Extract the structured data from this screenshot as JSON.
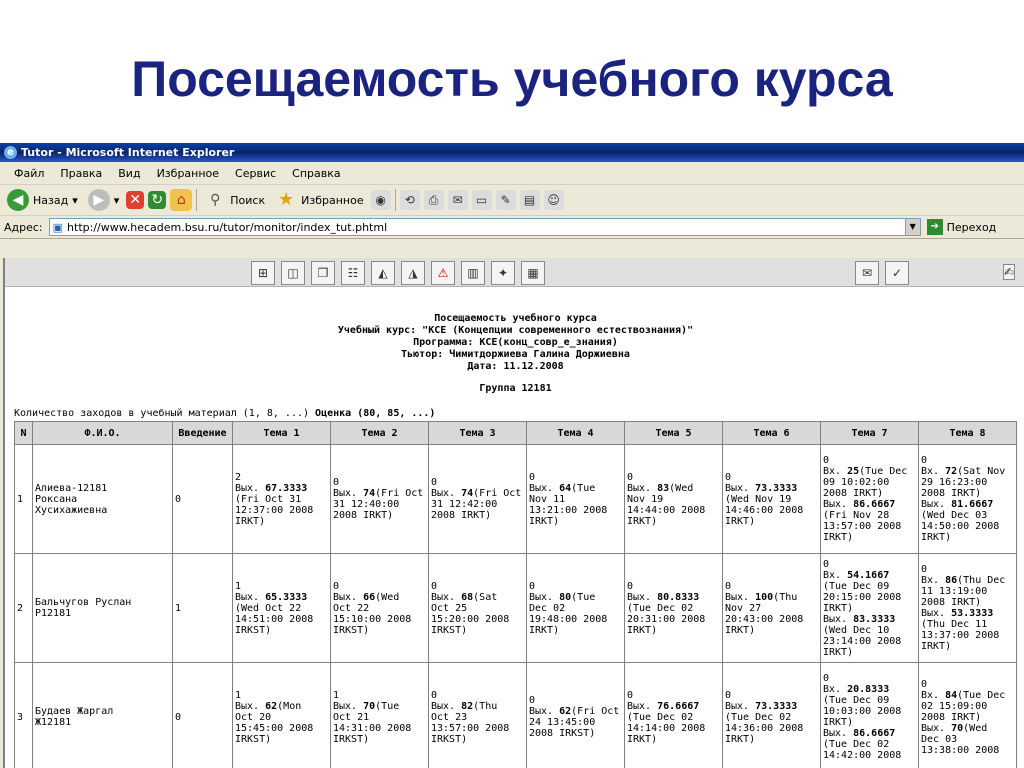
{
  "slide": {
    "title": "Посещаемость учебного курса"
  },
  "window": {
    "title": "Tutor - Microsoft Internet Explorer"
  },
  "menu": [
    "Файл",
    "Правка",
    "Вид",
    "Избранное",
    "Сервис",
    "Справка"
  ],
  "toolbar": {
    "back": "Назад",
    "search": "Поиск",
    "favorites": "Избранное"
  },
  "address": {
    "label": "Адрес:",
    "url": "http://www.hecadem.bsu.ru/tutor/monitor/index_tut.phtml",
    "go": "Переход"
  },
  "report": {
    "title": "Посещаемость учебного курса",
    "course": "Учебный курс: \"КСЕ (Концепции современного естествознания)\"",
    "program": "Программа: КСЕ(конц_совр_е_знания)",
    "tutor": "Тьютор: Чимитдоржиева Галина Доржиевна",
    "date": "Дата: 11.12.2008",
    "group": "Группа 12181",
    "visits_label": "Количество заходов в учебный материал (1, 8, ...)",
    "grade_label": "Оценка (80, 85, ...)"
  },
  "table": {
    "headers": [
      "N",
      "Ф.И.О.",
      "Введение",
      "Тема 1",
      "Тема 2",
      "Тема 3",
      "Тема 4",
      "Тема 5",
      "Тема 6",
      "Тема 7",
      "Тема 8"
    ],
    "rows": [
      {
        "n": "1",
        "name": "Алиева-12181\nРоксана\nХусихажиевна",
        "intro": "0",
        "topics": [
          "2\nВых. 67.3333\n(Fri Oct 31\n12:37:00 2008\nIRKT)",
          "0\nВых. 74(Fri Oct\n31 12:40:00\n2008 IRKT)",
          "0\nВых. 74(Fri Oct\n31 12:42:00\n2008 IRKT)",
          "0\nВых. 64(Tue\nNov 11\n13:21:00 2008\nIRKT)",
          "0\nВых. 83(Wed\nNov 19\n14:44:00 2008\nIRKT)",
          "0\nВых. 73.3333\n(Wed Nov 19\n14:46:00 2008\nIRKT)",
          "0\nВх. 25(Tue Dec\n09 10:02:00\n2008 IRKT)\nВых. 86.6667\n(Fri Nov 28\n13:57:00 2008\nIRKT)",
          "0\nВх. 72(Sat Nov\n29 16:23:00\n2008 IRKT)\nВых. 81.6667\n(Wed Dec 03\n14:50:00 2008\nIRKT)"
        ]
      },
      {
        "n": "2",
        "name": "Бальчугов Руслан\nР12181",
        "intro": "1",
        "topics": [
          "1\nВых. 65.3333\n(Wed Oct 22\n14:51:00 2008\nIRKST)",
          "0\nВых. 66(Wed\nOct 22\n15:10:00 2008\nIRKST)",
          "0\nВых. 68(Sat\nOct 25\n15:20:00 2008\nIRKST)",
          "0\nВых. 80(Tue\nDec 02\n19:48:00 2008\nIRKT)",
          "0\nВых. 80.8333\n(Tue Dec 02\n20:31:00 2008\nIRKT)",
          "0\nВых. 100(Thu\nNov 27\n20:43:00 2008\nIRKT)",
          "0\nВх. 54.1667\n(Tue Dec 09\n20:15:00 2008\nIRKT)\nВых. 83.3333\n(Wed Dec 10\n23:14:00 2008\nIRKT)",
          "0\nВх. 86(Thu Dec\n11 13:19:00\n2008 IRKT)\nВых. 53.3333\n(Thu Dec 11\n13:37:00 2008\nIRKT)"
        ]
      },
      {
        "n": "3",
        "name": "Будаев Жаргал\nЖ12181",
        "intro": "0",
        "topics": [
          "1\nВых. 62(Mon\nOct 20\n15:45:00 2008\nIRKST)",
          "1\nВых. 70(Tue\nOct 21\n14:31:00 2008\nIRKST)",
          "0\nВых. 82(Thu\nOct 23\n13:57:00 2008\nIRKST)",
          "0\nВых. 62(Fri Oct\n24 13:45:00\n2008 IRKST)",
          "0\nВых. 76.6667\n(Tue Dec 02\n14:14:00 2008\nIRKT)",
          "0\nВых. 73.3333\n(Tue Dec 02\n14:36:00 2008\nIRKT)",
          "0\nВх. 20.8333\n(Tue Dec 09\n10:03:00 2008\nIRKT)\nВых. 86.6667\n(Tue Dec 02\n14:42:00 2008",
          "0\nВх. 84(Tue Dec\n02 15:09:00\n2008 IRKT)\nВых. 70(Wed\nDec 03\n13:38:00 2008"
        ]
      }
    ]
  }
}
